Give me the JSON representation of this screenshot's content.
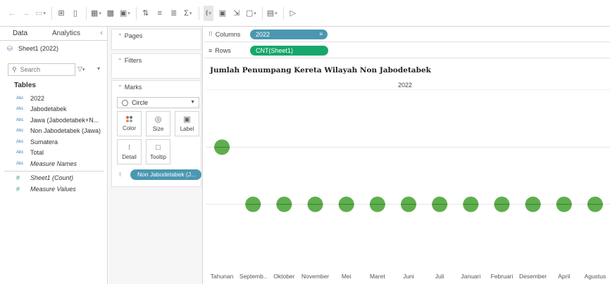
{
  "toolbar": {
    "icons": [
      "back-icon",
      "forward-icon",
      "data-source-icon",
      "add-datasource-icon",
      "pause-updates-icon",
      "new-worksheet-icon",
      "duplicate-sheet-icon",
      "clear-sheet-icon",
      "swap-icon",
      "sort-ascending-icon",
      "sort-descending-icon",
      "totals-icon",
      "highlight-icon",
      "labels-icon",
      "fix-axes-icon",
      "fit-icon",
      "show-cards-icon",
      "presentation-icon"
    ]
  },
  "data_panel": {
    "tab_data": "Data",
    "tab_analytics": "Analytics",
    "source": "Sheet1 (2022)",
    "search_placeholder": "Search",
    "tables_label": "Tables",
    "dimension_type": "Abc",
    "measure_type": "#",
    "dimensions": [
      "2022",
      "Jabodetabek",
      "Jawa (Jabodetabek+N...",
      "Non Jabodetabek (Jawa)",
      "Sumatera",
      "Total",
      "Measure Names"
    ],
    "measures": [
      "Sheet1 (Count)",
      "Measure Values"
    ]
  },
  "cards": {
    "pages": "Pages",
    "filters": "Filters",
    "marks": "Marks",
    "mark_type": "Circle",
    "buttons": [
      "Color",
      "Size",
      "Label",
      "Detail",
      "Tooltip"
    ],
    "detail_pill": "Non Jabodetabek (J..."
  },
  "shelves": {
    "columns_label": "Columns",
    "columns_pill": "2022",
    "rows_label": "Rows",
    "rows_pill": "CNT(Sheet1)"
  },
  "chart_data": {
    "type": "scatter",
    "title": "Jumlah Penumpang Kereta Wilayah Non Jabodetabek",
    "column_header": "2022",
    "categories": [
      "Tahunan",
      "Septemb..",
      "Oktober",
      "November",
      "Mei",
      "Maret",
      "Juni",
      "Juli",
      "Januari",
      "Februari",
      "Desember",
      "April",
      "Agustus"
    ],
    "values": [
      2,
      1,
      1,
      1,
      1,
      1,
      1,
      1,
      1,
      1,
      1,
      1,
      1
    ],
    "ylim": [
      0,
      3
    ],
    "grid": true,
    "mark_color": "#5fae4e"
  },
  "colors": {
    "dimension_pill": "#4b97b2",
    "measure_pill": "#16a76a",
    "mark": "#5fae4e"
  }
}
